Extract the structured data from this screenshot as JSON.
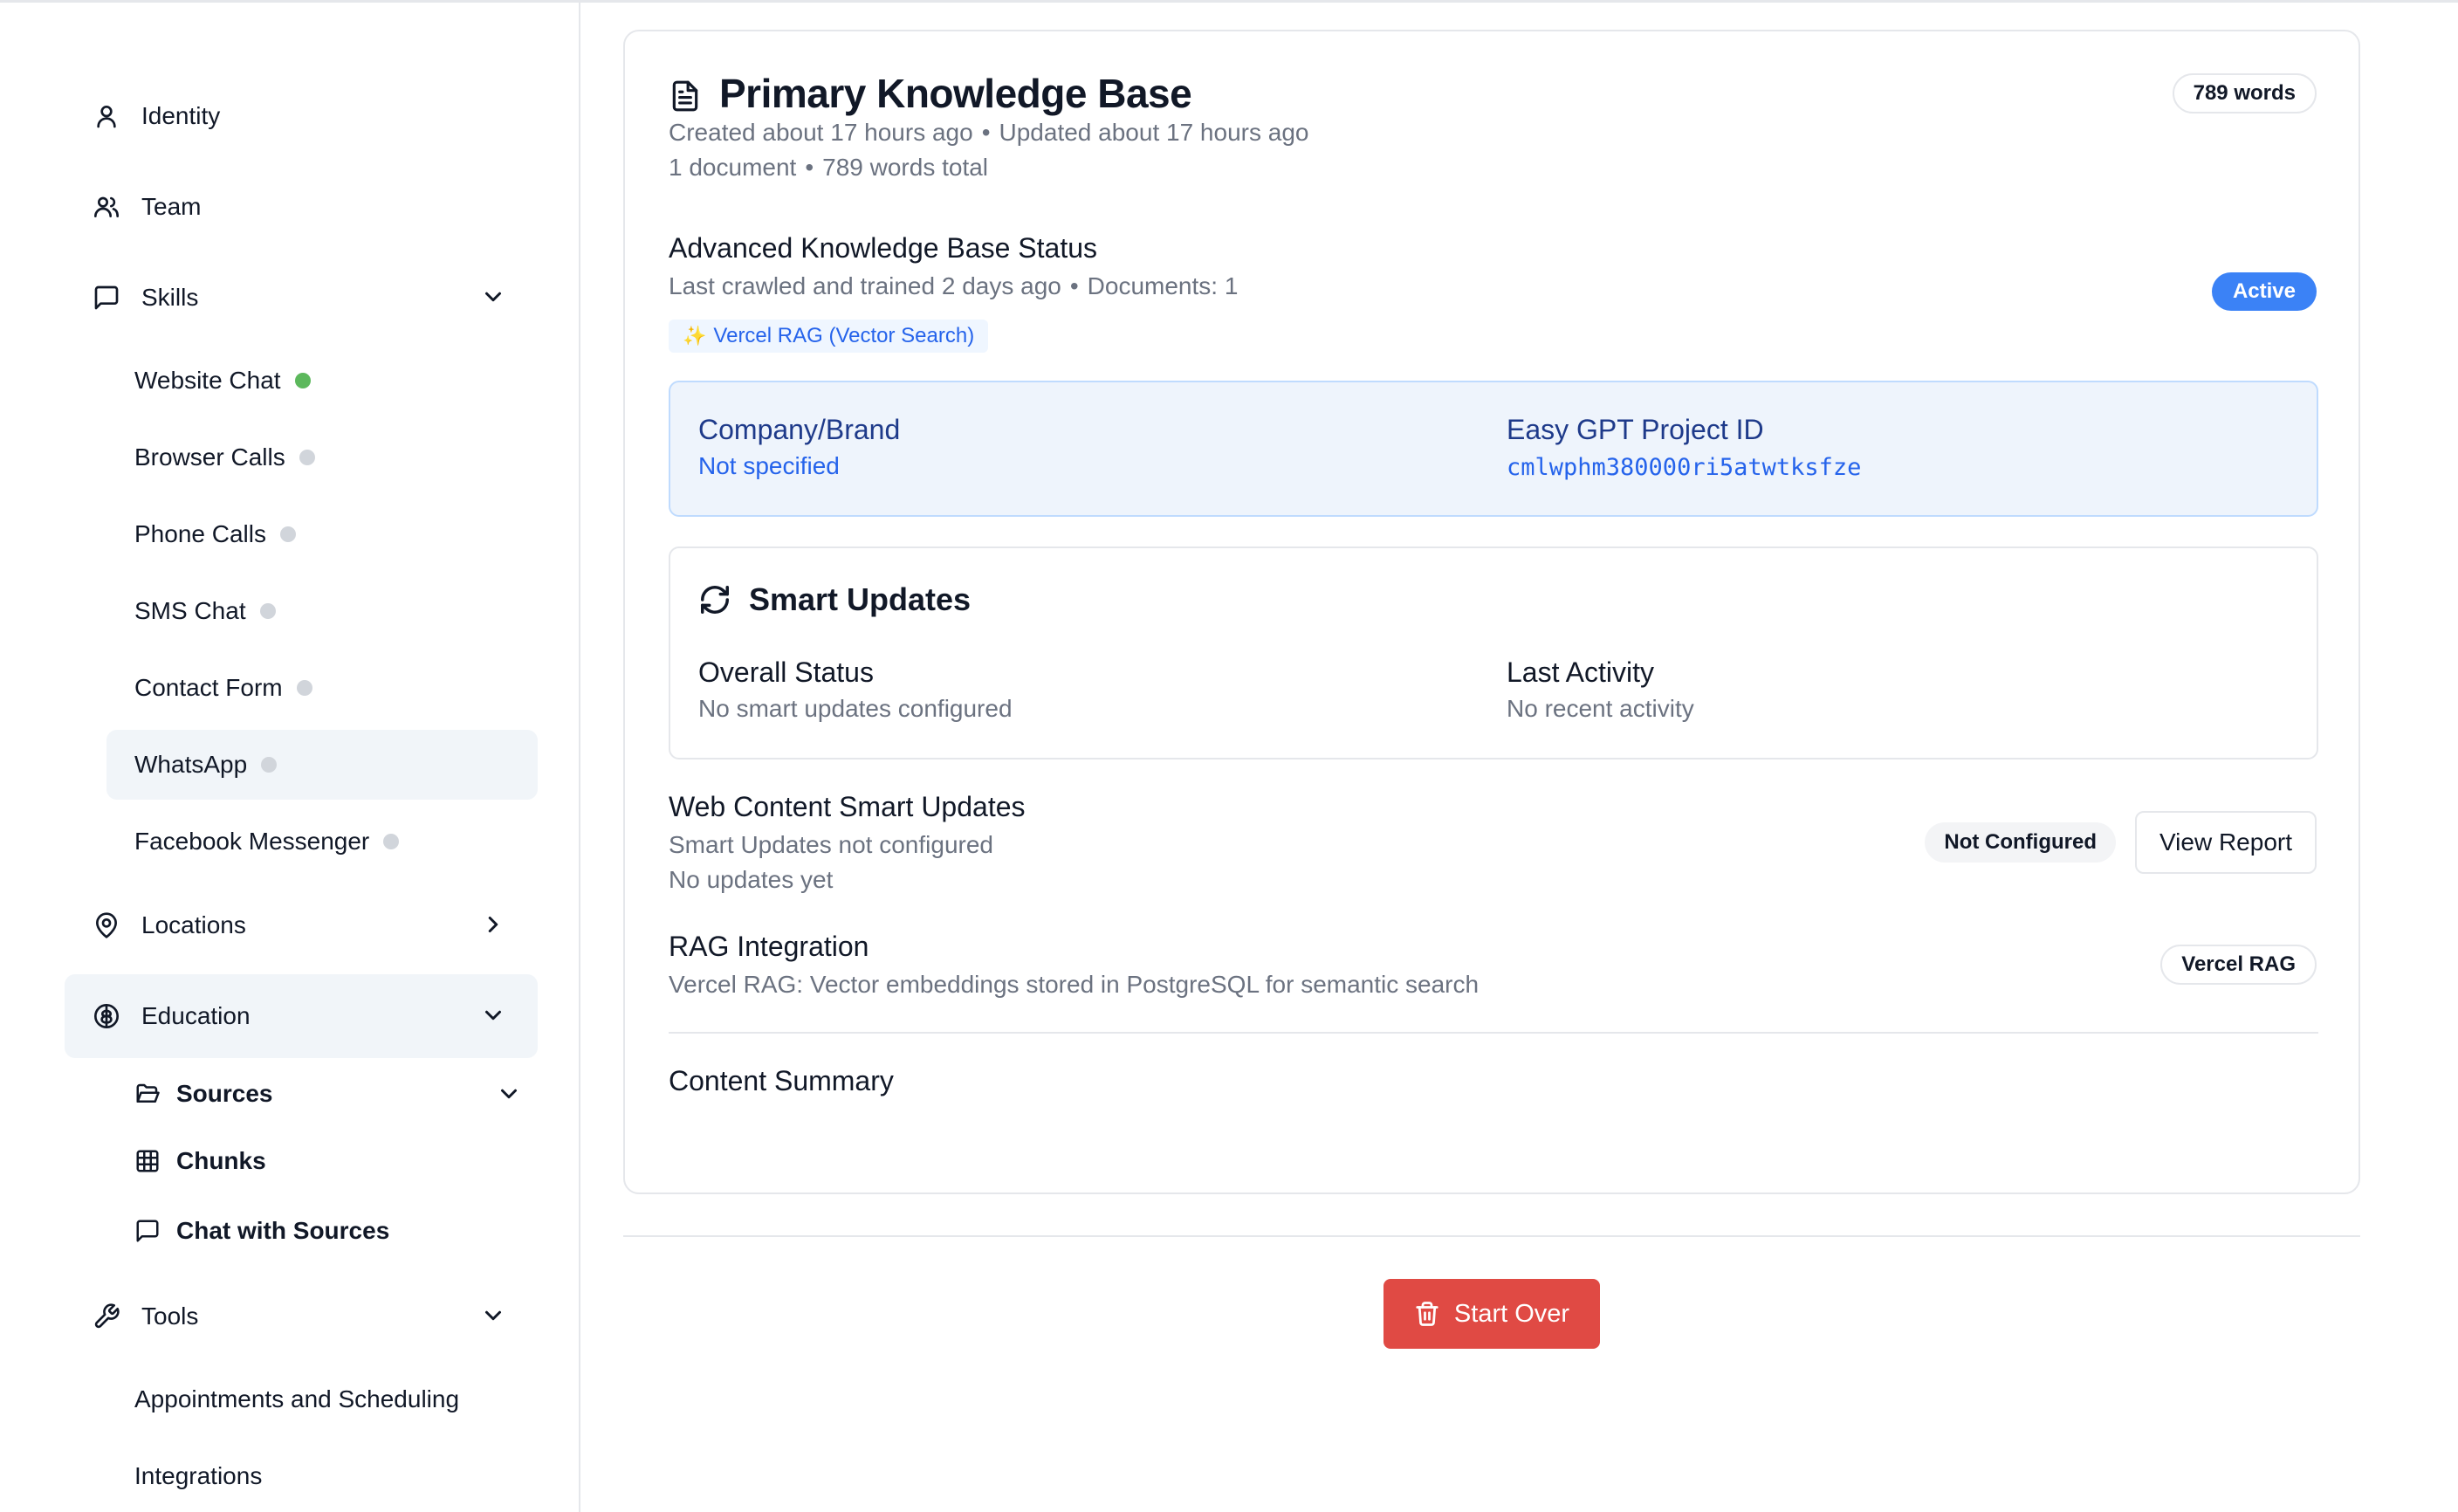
{
  "sidebar": {
    "identity": "Identity",
    "team": "Team",
    "skills": "Skills",
    "skill_items": [
      {
        "label": "Website Chat",
        "status": "active"
      },
      {
        "label": "Browser Calls",
        "status": "inactive"
      },
      {
        "label": "Phone Calls",
        "status": "inactive"
      },
      {
        "label": "SMS Chat",
        "status": "inactive"
      },
      {
        "label": "Contact Form",
        "status": "inactive"
      },
      {
        "label": "WhatsApp",
        "status": "inactive"
      },
      {
        "label": "Facebook Messenger",
        "status": "inactive"
      }
    ],
    "locations": "Locations",
    "education": "Education",
    "education_items": {
      "sources": "Sources",
      "chunks": "Chunks",
      "chat_with_sources": "Chat with Sources"
    },
    "tools": "Tools",
    "tool_items": [
      "Appointments and Scheduling",
      "Integrations"
    ]
  },
  "kb": {
    "title": "Primary Knowledge Base",
    "word_badge": "789 words",
    "created": "Created about 17 hours ago",
    "updated": "Updated about 17 hours ago",
    "documents": "1 document",
    "words_total": "789 words total",
    "bullet": "•"
  },
  "advanced": {
    "title": "Advanced Knowledge Base Status",
    "crawled": "Last crawled and trained 2 days ago",
    "documents": "Documents: 1",
    "status_badge": "Active",
    "rag_tag": "Vercel RAG (Vector Search)",
    "rag_tag_icon": "✨"
  },
  "info": {
    "company_label": "Company/Brand",
    "company_value": "Not specified",
    "project_label": "Easy GPT Project ID",
    "project_value": "cmlwphm380000ri5atwtksfze"
  },
  "smart_updates": {
    "title": "Smart Updates",
    "overall_label": "Overall Status",
    "overall_value": "No smart updates configured",
    "activity_label": "Last Activity",
    "activity_value": "No recent activity"
  },
  "web_content": {
    "title": "Web Content Smart Updates",
    "sub1": "Smart Updates not configured",
    "sub2": "No updates yet",
    "badge": "Not Configured",
    "button": "View Report"
  },
  "rag": {
    "title": "RAG Integration",
    "description": "Vercel RAG: Vector embeddings stored in PostgreSQL for semantic search",
    "badge": "Vercel RAG"
  },
  "content_summary": {
    "title": "Content Summary"
  },
  "footer": {
    "start_over": "Start Over"
  },
  "colors": {
    "accent_blue": "#3b82f6",
    "danger": "#e04a44",
    "status_active": "#5cb85c",
    "status_inactive": "#d1d5db"
  }
}
